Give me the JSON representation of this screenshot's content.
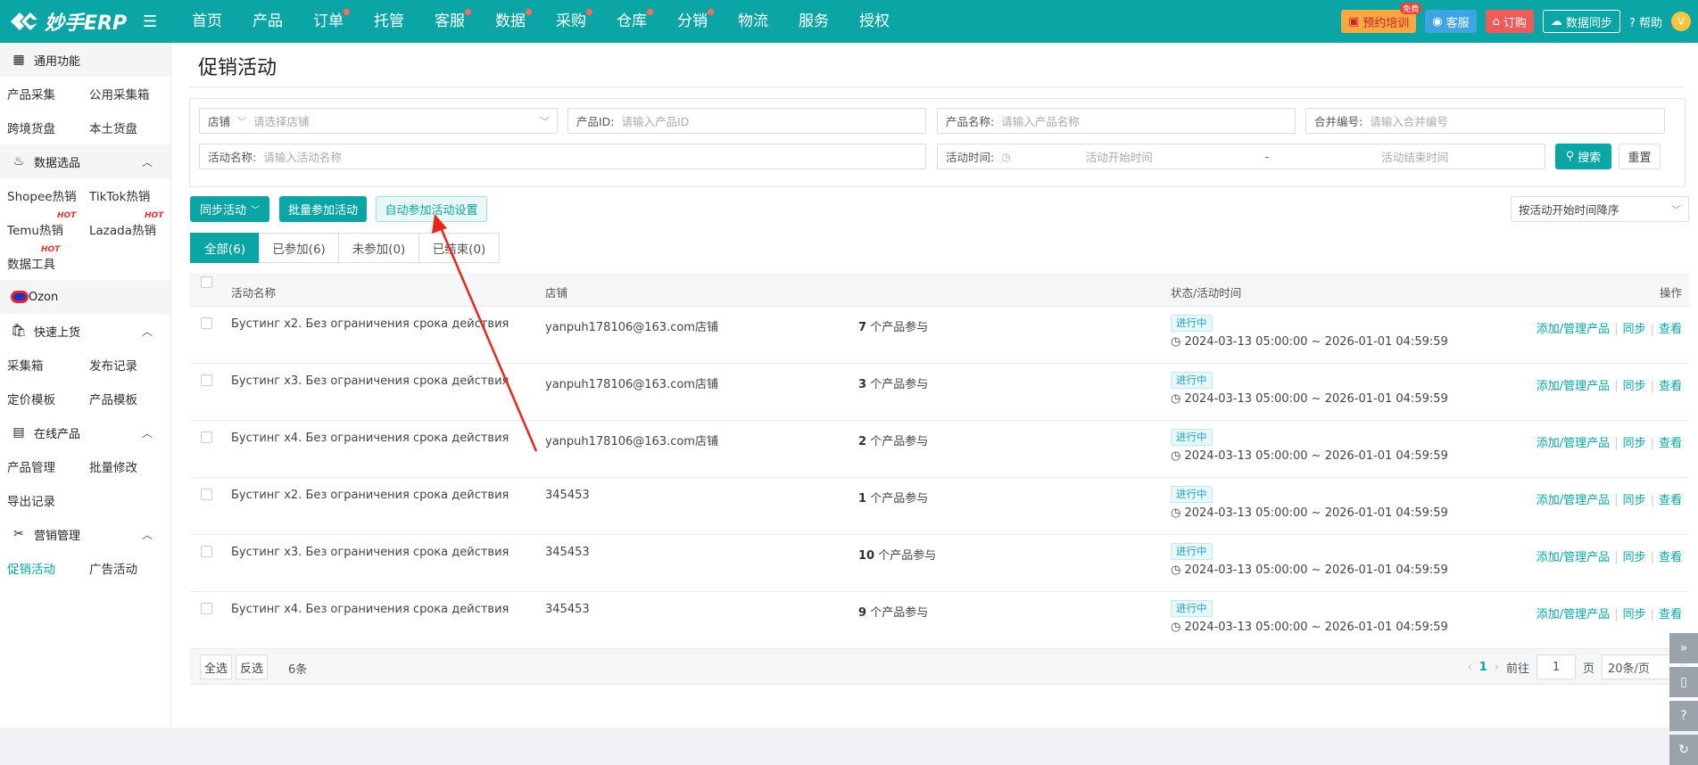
{
  "app": {
    "brand": "妙手ERP"
  },
  "nav": [
    {
      "label": "首页",
      "dot": false
    },
    {
      "label": "产品",
      "dot": false
    },
    {
      "label": "订单",
      "dot": true
    },
    {
      "label": "托管",
      "dot": false
    },
    {
      "label": "客服",
      "dot": true
    },
    {
      "label": "数据",
      "dot": true
    },
    {
      "label": "采购",
      "dot": true
    },
    {
      "label": "仓库",
      "dot": true
    },
    {
      "label": "分销",
      "dot": true
    },
    {
      "label": "物流",
      "dot": false
    },
    {
      "label": "服务",
      "dot": false
    },
    {
      "label": "授权",
      "dot": false
    }
  ],
  "topright": {
    "training": "预约培训",
    "training_tag": "免费",
    "service": "客服",
    "order": "订购",
    "sync": "数据同步",
    "help": "帮助",
    "avatar": "V"
  },
  "sidebar": {
    "g1": "通用功能",
    "g1_items": [
      "产品采集",
      "公用采集箱",
      "跨境货盘",
      "本土货盘"
    ],
    "g2": "数据选品",
    "g2_items": [
      "Shopee热销",
      "TikTok热销",
      "Temu热销",
      "Lazada热销",
      "数据工具"
    ],
    "hot": "HOT",
    "ozon": "Ozon",
    "g3": "快速上货",
    "g3_items": [
      "采集箱",
      "发布记录",
      "定价模板",
      "产品模板"
    ],
    "g4": "在线产品",
    "g4_items": [
      "产品管理",
      "批量修改",
      "导出记录"
    ],
    "g5": "营销管理",
    "g5_items": [
      "促销活动",
      "广告活动"
    ]
  },
  "page": {
    "title": "促销活动"
  },
  "filters": {
    "shop_label": "店铺",
    "shop_ph": "请选择店铺",
    "pid_label": "产品ID:",
    "pid_ph": "请输入产品ID",
    "pname_label": "产品名称:",
    "pname_ph": "请输入产品名称",
    "merge_label": "合并编号:",
    "merge_ph": "请输入合并编号",
    "aname_label": "活动名称:",
    "aname_ph": "请输入活动名称",
    "time_label": "活动时间:",
    "start_ph": "活动开始时间",
    "dash": "-",
    "end_ph": "活动结束时间",
    "search": "搜索",
    "reset": "重置"
  },
  "actions": {
    "sync": "同步活动",
    "batch": "批量参加活动",
    "auto": "自动参加活动设置",
    "sort": "按活动开始时间降序"
  },
  "tabs": [
    "全部(6)",
    "已参加(6)",
    "未参加(0)",
    "已结束(0)"
  ],
  "table": {
    "headers": {
      "name": "活动名称",
      "shop": "店铺",
      "status": "状态/活动时间",
      "ops": "操作"
    },
    "count_suffix": "个产品参与",
    "op_manage": "添加/管理产品",
    "op_sync": "同步",
    "op_view": "查看",
    "rows": [
      {
        "name": "Бустинг x2. Без ограничения срока действия",
        "shop": "yanpuh178106@163.com店铺",
        "count": "7",
        "status": "进行中",
        "time": "2024-03-13 05:00:00 ~ 2026-01-01 04:59:59"
      },
      {
        "name": "Бустинг x3. Без ограничения срока действия",
        "shop": "yanpuh178106@163.com店铺",
        "count": "3",
        "status": "进行中",
        "time": "2024-03-13 05:00:00 ~ 2026-01-01 04:59:59"
      },
      {
        "name": "Бустинг x4. Без ограничения срока действия",
        "shop": "yanpuh178106@163.com店铺",
        "count": "2",
        "status": "进行中",
        "time": "2024-03-13 05:00:00 ~ 2026-01-01 04:59:59"
      },
      {
        "name": "Бустинг x2. Без ограничения срока действия",
        "shop": "345453",
        "count": "1",
        "status": "进行中",
        "time": "2024-03-13 05:00:00 ~ 2026-01-01 04:59:59"
      },
      {
        "name": "Бустинг x3. Без ограничения срока действия",
        "shop": "345453",
        "count": "10",
        "status": "进行中",
        "time": "2024-03-13 05:00:00 ~ 2026-01-01 04:59:59"
      },
      {
        "name": "Бустинг x4. Без ограничения срока действия",
        "shop": "345453",
        "count": "9",
        "status": "进行中",
        "time": "2024-03-13 05:00:00 ~ 2026-01-01 04:59:59"
      }
    ]
  },
  "footer": {
    "select_all": "全选",
    "invert": "反选",
    "total": "6条",
    "page": "1",
    "goto": "前往",
    "goto_val": "1",
    "page_unit": "页",
    "page_size": "20条/页"
  },
  "colors": {
    "brand": "#0ba5a6",
    "status": "#1fa6c7",
    "annotation": "#e8261e"
  }
}
